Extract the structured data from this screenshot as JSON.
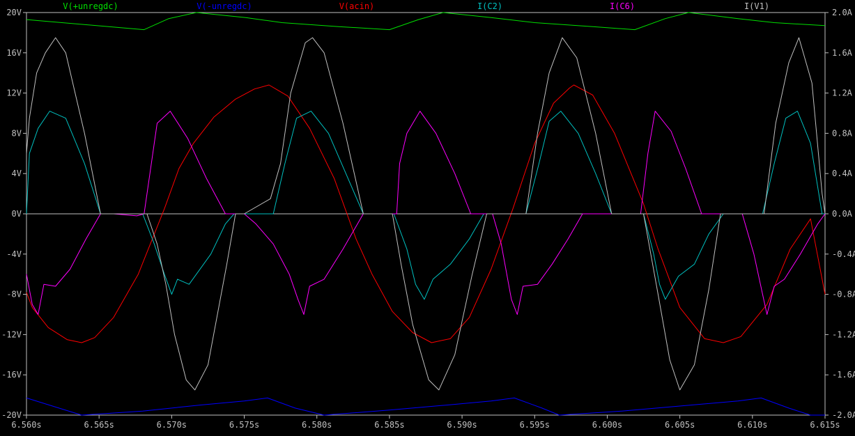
{
  "chart_data": {
    "type": "line",
    "title": "",
    "xlabel": "",
    "ylabel": "",
    "x_unit": "s",
    "x_range": [
      6.56,
      6.615
    ],
    "x_ticks": [
      "6.560s",
      "6.565s",
      "6.570s",
      "6.575s",
      "6.580s",
      "6.585s",
      "6.590s",
      "6.595s",
      "6.600s",
      "6.605s",
      "6.610s",
      "6.615s"
    ],
    "left_axis": {
      "unit": "V",
      "range": [
        -20,
        20
      ],
      "ticks": [
        "20V",
        "16V",
        "12V",
        "8V",
        "4V",
        "0V",
        "-4V",
        "-8V",
        "-12V",
        "-16V",
        "-20V"
      ]
    },
    "right_axis": {
      "unit": "A",
      "range": [
        -2,
        2
      ],
      "ticks": [
        "2.0A",
        "1.6A",
        "1.2A",
        "0.8A",
        "0.4A",
        "0.0A",
        "-0.4A",
        "-0.8A",
        "-1.2A",
        "-1.6A",
        "-2.0A"
      ]
    },
    "grid": false,
    "legend_position": "top",
    "colors": {
      "background": "#000000",
      "axis": "#c0c0c0",
      "tick_text": "#c0c0c0"
    },
    "series": [
      {
        "name": "V(+unregdc)",
        "axis": "left",
        "color": "#00e000",
        "points": [
          [
            6.56,
            19.3
          ],
          [
            6.5681,
            18.3
          ],
          [
            6.5698,
            19.4
          ],
          [
            6.5717,
            20.0
          ],
          [
            6.5751,
            19.5
          ],
          [
            6.5776,
            19.0
          ],
          [
            6.5815,
            18.6
          ],
          [
            6.585,
            18.3
          ],
          [
            6.587,
            19.3
          ],
          [
            6.5887,
            20.0
          ],
          [
            6.592,
            19.5
          ],
          [
            6.595,
            19.0
          ],
          [
            6.599,
            18.6
          ],
          [
            6.6019,
            18.3
          ],
          [
            6.604,
            19.4
          ],
          [
            6.6056,
            20.0
          ],
          [
            6.609,
            19.4
          ],
          [
            6.6115,
            19.0
          ],
          [
            6.615,
            18.7
          ]
        ]
      },
      {
        "name": "V(-unregdc)",
        "axis": "left",
        "color": "#0000ff",
        "points": [
          [
            6.56,
            -18.3
          ],
          [
            6.562,
            -19.2
          ],
          [
            6.5638,
            -20.0
          ],
          [
            6.568,
            -19.6
          ],
          [
            6.572,
            -19.0
          ],
          [
            6.575,
            -18.6
          ],
          [
            6.5766,
            -18.3
          ],
          [
            6.5785,
            -19.3
          ],
          [
            6.5805,
            -20.0
          ],
          [
            6.585,
            -19.5
          ],
          [
            6.589,
            -19.0
          ],
          [
            6.592,
            -18.6
          ],
          [
            6.5936,
            -18.3
          ],
          [
            6.5955,
            -19.3
          ],
          [
            6.5967,
            -20.0
          ],
          [
            6.601,
            -19.6
          ],
          [
            6.605,
            -19.1
          ],
          [
            6.609,
            -18.6
          ],
          [
            6.6106,
            -18.3
          ],
          [
            6.6125,
            -19.3
          ],
          [
            6.614,
            -20.0
          ],
          [
            6.615,
            -20.0
          ]
        ]
      },
      {
        "name": "V(acin)",
        "axis": "left",
        "color": "#ff0000",
        "points": [
          [
            6.56,
            -7.8
          ],
          [
            6.5604,
            -9.3
          ],
          [
            6.5615,
            -11.3
          ],
          [
            6.5628,
            -12.5
          ],
          [
            6.5638,
            -12.8
          ],
          [
            6.5647,
            -12.3
          ],
          [
            6.566,
            -10.3
          ],
          [
            6.5677,
            -6.0
          ],
          [
            6.5695,
            0.5
          ],
          [
            6.5705,
            4.5
          ],
          [
            6.5715,
            7.0
          ],
          [
            6.5729,
            9.6
          ],
          [
            6.5744,
            11.4
          ],
          [
            6.5757,
            12.4
          ],
          [
            6.5767,
            12.8
          ],
          [
            6.578,
            11.7
          ],
          [
            6.5795,
            8.5
          ],
          [
            6.5812,
            3.5
          ],
          [
            6.5827,
            -2.5
          ],
          [
            6.5838,
            -6.0
          ],
          [
            6.5852,
            -9.7
          ],
          [
            6.5866,
            -11.8
          ],
          [
            6.5879,
            -12.8
          ],
          [
            6.5892,
            -12.4
          ],
          [
            6.5905,
            -10.3
          ],
          [
            6.592,
            -5.5
          ],
          [
            6.5935,
            0.5
          ],
          [
            6.595,
            7.0
          ],
          [
            6.5963,
            11.0
          ],
          [
            6.5974,
            12.5
          ],
          [
            6.5977,
            12.8
          ],
          [
            6.599,
            11.8
          ],
          [
            6.6005,
            8.0
          ],
          [
            6.6025,
            1.0
          ],
          [
            6.6035,
            -3.5
          ],
          [
            6.605,
            -9.3
          ],
          [
            6.6067,
            -12.4
          ],
          [
            6.608,
            -12.8
          ],
          [
            6.6092,
            -12.2
          ],
          [
            6.611,
            -9.0
          ],
          [
            6.6126,
            -3.5
          ],
          [
            6.614,
            -0.5
          ],
          [
            6.615,
            -8.0
          ]
        ]
      },
      {
        "name": "I(C2)",
        "axis": "right",
        "color": "#00c0c0",
        "points": [
          [
            6.56,
            0.0
          ],
          [
            6.5602,
            0.6
          ],
          [
            6.5608,
            0.85
          ],
          [
            6.5616,
            1.02
          ],
          [
            6.5627,
            0.95
          ],
          [
            6.564,
            0.5
          ],
          [
            6.5651,
            0.0
          ],
          [
            6.568,
            0.0
          ],
          [
            6.5688,
            -0.3
          ],
          [
            6.5695,
            -0.6
          ],
          [
            6.57,
            -0.8
          ],
          [
            6.5704,
            -0.65
          ],
          [
            6.5712,
            -0.7
          ],
          [
            6.5727,
            -0.4
          ],
          [
            6.5737,
            -0.1
          ],
          [
            6.5743,
            0.0
          ],
          [
            6.577,
            0.0
          ],
          [
            6.5778,
            0.5
          ],
          [
            6.5786,
            0.95
          ],
          [
            6.5796,
            1.02
          ],
          [
            6.5808,
            0.8
          ],
          [
            6.582,
            0.4
          ],
          [
            6.5832,
            0.0
          ],
          [
            6.5853,
            0.0
          ],
          [
            6.5862,
            -0.35
          ],
          [
            6.5868,
            -0.7
          ],
          [
            6.5874,
            -0.85
          ],
          [
            6.588,
            -0.65
          ],
          [
            6.5892,
            -0.5
          ],
          [
            6.5905,
            -0.25
          ],
          [
            6.5915,
            0.0
          ],
          [
            6.5944,
            0.0
          ],
          [
            6.5953,
            0.5
          ],
          [
            6.596,
            0.92
          ],
          [
            6.5968,
            1.02
          ],
          [
            6.598,
            0.8
          ],
          [
            6.5992,
            0.4
          ],
          [
            6.6003,
            0.0
          ],
          [
            6.6025,
            0.0
          ],
          [
            6.6032,
            -0.4
          ],
          [
            6.6036,
            -0.7
          ],
          [
            6.604,
            -0.85
          ],
          [
            6.6049,
            -0.62
          ],
          [
            6.606,
            -0.5
          ],
          [
            6.607,
            -0.2
          ],
          [
            6.608,
            0.0
          ],
          [
            6.6107,
            0.0
          ],
          [
            6.6115,
            0.5
          ],
          [
            6.6123,
            0.95
          ],
          [
            6.6131,
            1.02
          ],
          [
            6.614,
            0.7
          ],
          [
            6.6148,
            0.0
          ],
          [
            6.615,
            0.0
          ]
        ]
      },
      {
        "name": "I(C6)",
        "axis": "right",
        "color": "#ff00ff",
        "points": [
          [
            6.56,
            -0.6
          ],
          [
            6.5604,
            -0.9
          ],
          [
            6.5608,
            -1.0
          ],
          [
            6.5612,
            -0.7
          ],
          [
            6.562,
            -0.72
          ],
          [
            6.563,
            -0.55
          ],
          [
            6.5641,
            -0.25
          ],
          [
            6.5651,
            0.0
          ],
          [
            6.566,
            0.0
          ],
          [
            6.5676,
            -0.02
          ],
          [
            6.5681,
            0.0
          ],
          [
            6.5686,
            0.5
          ],
          [
            6.569,
            0.9
          ],
          [
            6.5699,
            1.02
          ],
          [
            6.5711,
            0.75
          ],
          [
            6.5724,
            0.35
          ],
          [
            6.5737,
            0.0
          ],
          [
            6.575,
            0.0
          ],
          [
            6.5758,
            -0.1
          ],
          [
            6.577,
            -0.3
          ],
          [
            6.5781,
            -0.6
          ],
          [
            6.5787,
            -0.85
          ],
          [
            6.5791,
            -1.0
          ],
          [
            6.5795,
            -0.72
          ],
          [
            6.5805,
            -0.65
          ],
          [
            6.5818,
            -0.35
          ],
          [
            6.5832,
            0.0
          ],
          [
            6.5855,
            0.0
          ],
          [
            6.5857,
            0.5
          ],
          [
            6.5862,
            0.8
          ],
          [
            6.5871,
            1.02
          ],
          [
            6.5882,
            0.8
          ],
          [
            6.5895,
            0.4
          ],
          [
            6.5906,
            0.0
          ],
          [
            6.5921,
            0.0
          ],
          [
            6.5927,
            -0.3
          ],
          [
            6.5934,
            -0.85
          ],
          [
            6.5938,
            -1.0
          ],
          [
            6.5942,
            -0.72
          ],
          [
            6.5952,
            -0.7
          ],
          [
            6.5962,
            -0.5
          ],
          [
            6.5973,
            -0.25
          ],
          [
            6.5983,
            0.0
          ],
          [
            6.6023,
            0.0
          ],
          [
            6.6028,
            0.6
          ],
          [
            6.6033,
            1.02
          ],
          [
            6.6044,
            0.82
          ],
          [
            6.6054,
            0.45
          ],
          [
            6.6065,
            0.0
          ],
          [
            6.6093,
            0.0
          ],
          [
            6.6101,
            -0.4
          ],
          [
            6.6107,
            -0.8
          ],
          [
            6.611,
            -1.0
          ],
          [
            6.6115,
            -0.72
          ],
          [
            6.6122,
            -0.65
          ],
          [
            6.6133,
            -0.4
          ],
          [
            6.6145,
            -0.1
          ],
          [
            6.615,
            0.0
          ]
        ]
      },
      {
        "name": "I(V1)",
        "axis": "right",
        "color": "#c0c0c0",
        "points": [
          [
            6.56,
            0.6
          ],
          [
            6.5602,
            0.95
          ],
          [
            6.5607,
            1.4
          ],
          [
            6.5613,
            1.6
          ],
          [
            6.562,
            1.75
          ],
          [
            6.5627,
            1.6
          ],
          [
            6.564,
            0.8
          ],
          [
            6.5651,
            0.0
          ],
          [
            6.5683,
            0.0
          ],
          [
            6.569,
            -0.3
          ],
          [
            6.5696,
            -0.7
          ],
          [
            6.5702,
            -1.2
          ],
          [
            6.571,
            -1.65
          ],
          [
            6.5716,
            -1.75
          ],
          [
            6.5725,
            -1.5
          ],
          [
            6.5738,
            -0.5
          ],
          [
            6.5744,
            0.0
          ],
          [
            6.575,
            0.0
          ],
          [
            6.5768,
            0.15
          ],
          [
            6.5775,
            0.5
          ],
          [
            6.5782,
            1.2
          ],
          [
            6.5792,
            1.7
          ],
          [
            6.5797,
            1.75
          ],
          [
            6.5805,
            1.6
          ],
          [
            6.5818,
            0.9
          ],
          [
            6.5832,
            0.0
          ],
          [
            6.5852,
            0.0
          ],
          [
            6.5858,
            -0.5
          ],
          [
            6.5866,
            -1.1
          ],
          [
            6.5877,
            -1.65
          ],
          [
            6.5884,
            -1.75
          ],
          [
            6.5895,
            -1.4
          ],
          [
            6.5907,
            -0.6
          ],
          [
            6.5917,
            0.0
          ],
          [
            6.5944,
            0.0
          ],
          [
            6.5952,
            0.8
          ],
          [
            6.596,
            1.4
          ],
          [
            6.5969,
            1.75
          ],
          [
            6.5979,
            1.55
          ],
          [
            6.5992,
            0.8
          ],
          [
            6.6003,
            0.0
          ],
          [
            6.6025,
            0.0
          ],
          [
            6.6035,
            -0.8
          ],
          [
            6.6043,
            -1.45
          ],
          [
            6.605,
            -1.75
          ],
          [
            6.606,
            -1.5
          ],
          [
            6.607,
            -0.75
          ],
          [
            6.6078,
            0.0
          ],
          [
            6.6108,
            0.0
          ],
          [
            6.6116,
            0.9
          ],
          [
            6.6125,
            1.5
          ],
          [
            6.6132,
            1.75
          ],
          [
            6.6141,
            1.3
          ],
          [
            6.6148,
            0.2
          ],
          [
            6.615,
            0.0
          ]
        ]
      }
    ]
  }
}
